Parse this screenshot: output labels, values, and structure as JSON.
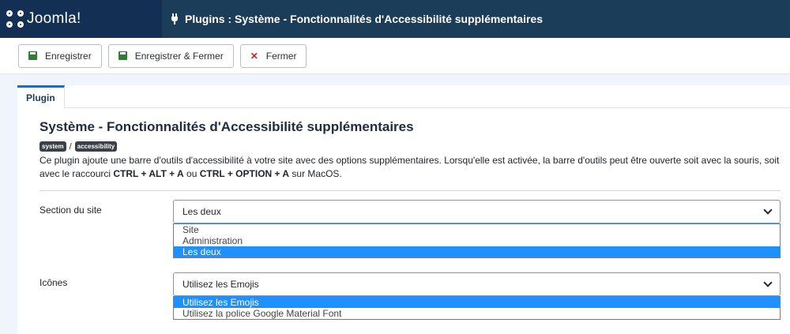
{
  "header": {
    "brand": "Joomla!",
    "title": "Plugins : Système - Fonctionnalités d'Accessibilité supplémentaires",
    "icon": "plug-icon"
  },
  "toolbar": {
    "save_label": "Enregistrer",
    "save_close_label": "Enregistrer & Fermer",
    "close_label": "Fermer"
  },
  "tabs": [
    {
      "label": "Plugin"
    }
  ],
  "plugin": {
    "title": "Système - Fonctionnalités d'Accessibilité supplémentaires",
    "badge_system": "system",
    "badge_sep": "/",
    "badge_accessibility": "accessibility",
    "desc_part1": "Ce plugin ajoute une barre d'outils d'accessibilité à votre site avec des options supplémentaires. Lorsqu'elle est activée, la barre d'outils peut être ouverte soit avec la souris, soit avec le raccourci ",
    "shortcut1": "CTRL + ALT + A",
    "desc_or": " ou ",
    "shortcut2": "CTRL + OPTION + A",
    "desc_end": " sur MacOS."
  },
  "fields": {
    "section": {
      "label": "Section du site",
      "value": "Les deux",
      "options": [
        "Site",
        "Administration",
        "Les deux"
      ],
      "selected_index": 2
    },
    "icons": {
      "label": "Icônes",
      "value": "Utilisez les Emojis",
      "options": [
        "Utilisez les Emojis",
        "Utilisez la police Google Material Font"
      ],
      "selected_index": 0
    }
  },
  "colors": {
    "header_bg": "#1c3d5a",
    "brand_bg": "#132f53",
    "accent": "#2a69b8",
    "option_highlight": "#1e90ff",
    "save_icon": "#2e7d32",
    "close_icon": "#c52827"
  }
}
